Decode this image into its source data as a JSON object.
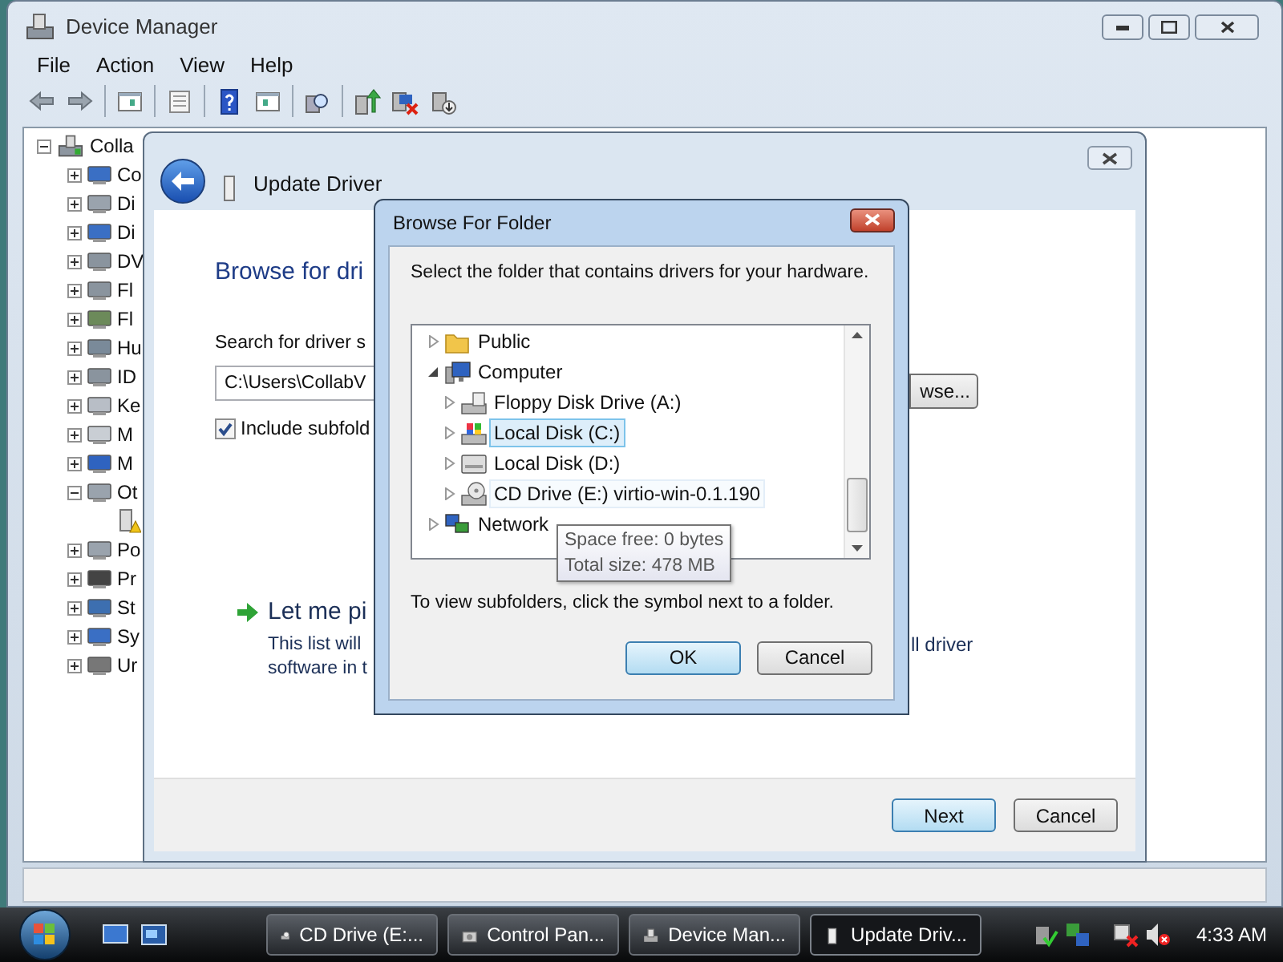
{
  "device_manager": {
    "title": "Device Manager",
    "menu": [
      "File",
      "Action",
      "View",
      "Help"
    ],
    "tree": {
      "label": "Colla",
      "expanded": true,
      "children": [
        {
          "label": "Co",
          "expanded": false
        },
        {
          "label": "Di",
          "expanded": false
        },
        {
          "label": "Di",
          "expanded": false
        },
        {
          "label": "DV",
          "expanded": false
        },
        {
          "label": "Fl",
          "expanded": false
        },
        {
          "label": "Fl",
          "expanded": false
        },
        {
          "label": "Hu",
          "expanded": false
        },
        {
          "label": "ID",
          "expanded": false
        },
        {
          "label": "Ke",
          "expanded": false
        },
        {
          "label": "M",
          "expanded": false
        },
        {
          "label": "M",
          "expanded": false
        },
        {
          "label": "Ot",
          "expanded": true,
          "children": [
            {
              "warning": true
            }
          ]
        },
        {
          "label": "Po",
          "expanded": false
        },
        {
          "label": "Pr",
          "expanded": false
        },
        {
          "label": "St",
          "expanded": false
        },
        {
          "label": "Sy",
          "expanded": false
        },
        {
          "label": "Ur",
          "expanded": false
        }
      ]
    }
  },
  "wizard": {
    "title": "Update Driver",
    "heading": "Browse for dri",
    "search_label": "Search for driver s",
    "path_field": "C:\\Users\\CollabV",
    "browse_button": "wse...",
    "include_subfolders": {
      "label": "Include subfold",
      "checked": true
    },
    "pick_link": "Let me pi",
    "pick_description": [
      "This list will",
      "software in t"
    ],
    "pick_description_right": "ll driver",
    "buttons": [
      "Next",
      "Cancel"
    ]
  },
  "browse_dialog": {
    "title": "Browse For Folder",
    "instruction": "Select the folder that contains drivers for your hardware.",
    "folders": [
      {
        "label": "Public",
        "kind": "folder",
        "expanded": false,
        "selected": false,
        "hovered": false
      },
      {
        "label": "Computer",
        "kind": "computer",
        "expanded": true,
        "selected": false,
        "hovered": false,
        "children": [
          {
            "label": "Floppy Disk Drive (A:)",
            "kind": "floppy",
            "expanded": false,
            "selected": false,
            "hovered": false
          },
          {
            "label": "Local Disk (C:)",
            "kind": "system_disk",
            "expanded": false,
            "selected": true,
            "hovered": false
          },
          {
            "label": "Local Disk (D:)",
            "kind": "disk",
            "expanded": false,
            "selected": false,
            "hovered": false
          },
          {
            "label": "CD Drive (E:) virtio-win-0.1.190",
            "kind": "cd",
            "expanded": false,
            "selected": false,
            "hovered": true
          }
        ]
      },
      {
        "label": "Network",
        "kind": "network",
        "expanded": false,
        "selected": false,
        "hovered": false
      }
    ],
    "tooltip": [
      "Space free: 0 bytes",
      "Total size: 478 MB"
    ],
    "hint": "To view subfolders, click the symbol next to a folder.",
    "buttons": [
      "OK",
      "Cancel"
    ]
  },
  "taskbar": {
    "tasks": [
      {
        "label": "CD Drive (E:...",
        "selected": false
      },
      {
        "label": "Control Pan...",
        "selected": false
      },
      {
        "label": "Device Man...",
        "selected": false
      },
      {
        "label": "Update Driv...",
        "selected": true
      }
    ],
    "clock": "4:33 AM"
  }
}
